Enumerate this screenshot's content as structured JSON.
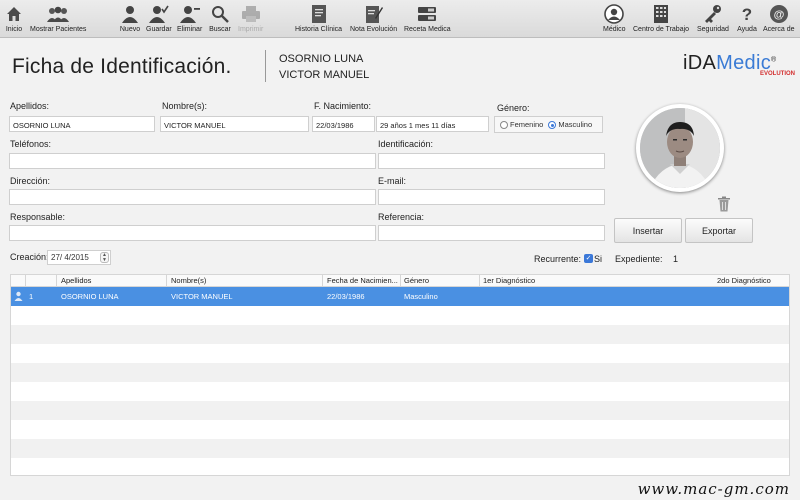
{
  "toolbar": {
    "left": [
      {
        "label": "Inicio",
        "icon": "home-icon"
      },
      {
        "label": "Mostrar Pacientes",
        "icon": "patients-icon"
      },
      {
        "label": "Nuevo",
        "icon": "new-user-icon"
      },
      {
        "label": "Guardar",
        "icon": "save-user-icon"
      },
      {
        "label": "Eliminar",
        "icon": "delete-user-icon"
      },
      {
        "label": "Buscar",
        "icon": "search-icon"
      },
      {
        "label": "Imprimir",
        "icon": "printer-icon",
        "disabled": true
      },
      {
        "label": "Historia Clínica",
        "icon": "clinical-history-icon"
      },
      {
        "label": "Nota Evolución",
        "icon": "evolution-note-icon"
      },
      {
        "label": "Receta Medica",
        "icon": "prescription-icon"
      }
    ],
    "right": [
      {
        "label": "Médico",
        "icon": "doctor-icon"
      },
      {
        "label": "Centro de Trabajo",
        "icon": "building-icon"
      },
      {
        "label": "Seguridad",
        "icon": "key-icon"
      },
      {
        "label": "Ayuda",
        "icon": "help-icon"
      },
      {
        "label": "Acerca de",
        "icon": "about-icon"
      }
    ]
  },
  "header": {
    "title": "Ficha de Identificación.",
    "patient_line1": "OSORNIO LUNA",
    "patient_line2": "VICTOR MANUEL",
    "logo_i": "iDA",
    "logo_med": "Medic",
    "logo_reg": "®",
    "logo_sub": "EVOLUTION"
  },
  "form": {
    "apellidos_label": "Apellidos:",
    "apellidos_value": "OSORNIO LUNA",
    "nombres_label": "Nombre(s):",
    "nombres_value": "VICTOR MANUEL",
    "nacimiento_label": "F. Nacimiento:",
    "nacimiento_value": "22/03/1986",
    "edad_value": "29 años 1 mes 11 días",
    "genero_label": "Género:",
    "genero_options": [
      "Femenino",
      "Masculino"
    ],
    "genero_selected": "Masculino",
    "telefonos_label": "Teléfonos:",
    "telefonos_value": "",
    "identificacion_label": "Identificación:",
    "identificacion_value": "",
    "direccion_label": "Dirección:",
    "direccion_value": "",
    "email_label": "E-mail:",
    "email_value": "",
    "responsable_label": "Responsable:",
    "responsable_value": "",
    "referencia_label": "Referencia:",
    "referencia_value": "",
    "creacion_label": "Creación:",
    "creacion_value": "27/ 4/2015",
    "recurrente_label": "Recurrente:",
    "recurrente_checked": true,
    "recurrente_option": "Si",
    "expediente_label": "Expediente:",
    "expediente_value": "1",
    "insertar_label": "Insertar",
    "exportar_label": "Exportar"
  },
  "table": {
    "headers": [
      "Apellidos",
      "Nombre(s)",
      "Fecha de Nacimien...",
      "Género",
      "1er Diagnóstico",
      "2do Diagnóstico"
    ],
    "rows": [
      {
        "num": "1",
        "apellidos": "OSORNIO LUNA",
        "nombres": "VICTOR MANUEL",
        "fecha": "22/03/1986",
        "genero": "Masculino",
        "diag1": "",
        "diag2": ""
      }
    ],
    "empty_row_count": 10,
    "selected_color": "#4a90e2"
  },
  "watermark": "www.mac-gm.com",
  "colors": {
    "accent": "#3b78d8",
    "logo_blue": "#3a7bd5",
    "logo_red": "#d32f2f"
  }
}
